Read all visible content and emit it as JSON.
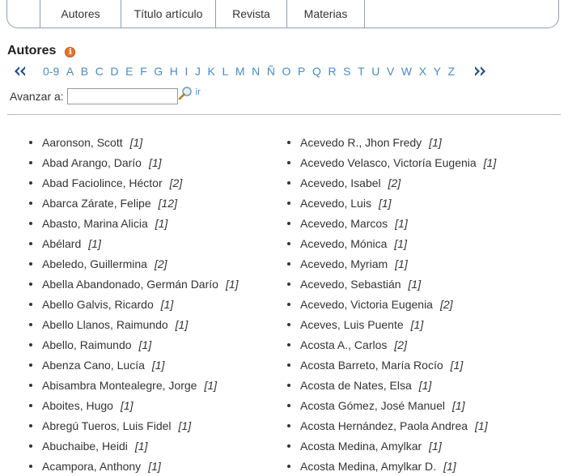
{
  "tabs": [
    "Autores",
    "Título artículo",
    "Revista",
    "Materias"
  ],
  "heading": "Autores",
  "alphabet": [
    "0-9",
    "A",
    "B",
    "C",
    "D",
    "E",
    "F",
    "G",
    "H",
    "I",
    "J",
    "K",
    "L",
    "M",
    "N",
    "Ñ",
    "O",
    "P",
    "Q",
    "R",
    "S",
    "T",
    "U",
    "V",
    "W",
    "X",
    "Y",
    "Z"
  ],
  "jump": {
    "label": "Avanzar a:",
    "value": "",
    "go_label": "ir"
  },
  "icons": {
    "info": "info-icon",
    "prev": "double-chevron-left-icon",
    "next": "double-chevron-right-icon",
    "search": "magnifier-icon"
  },
  "colors": {
    "link": "#4a8bc2",
    "nav_arrow": "#1f4f86",
    "info": "#e8752d",
    "border": "#8a9fb3"
  },
  "authors_left": [
    {
      "name": "Aaronson, Scott",
      "count": "[1]"
    },
    {
      "name": "Abad Arango, Darío",
      "count": "[1]"
    },
    {
      "name": "Abad Faciolince, Héctor",
      "count": "[2]"
    },
    {
      "name": "Abarca Zárate, Felipe",
      "count": "[12]"
    },
    {
      "name": "Abasto, Marina Alicia",
      "count": "[1]"
    },
    {
      "name": "Abélard",
      "count": "[1]"
    },
    {
      "name": "Abeledo, Guillermina",
      "count": "[2]"
    },
    {
      "name": "Abella Abandonado, Germán Darío",
      "count": "[1]"
    },
    {
      "name": "Abello Galvis, Ricardo",
      "count": "[1]"
    },
    {
      "name": "Abello Llanos, Raimundo",
      "count": "[1]"
    },
    {
      "name": "Abello, Raimundo",
      "count": "[1]"
    },
    {
      "name": "Abenza Cano, Lucía",
      "count": "[1]"
    },
    {
      "name": "Abisambra Montealegre, Jorge",
      "count": "[1]"
    },
    {
      "name": "Aboites, Hugo",
      "count": "[1]"
    },
    {
      "name": "Abregú Tueros, Luis Fidel",
      "count": "[1]"
    },
    {
      "name": "Abuchaibe, Heidi",
      "count": "[1]"
    },
    {
      "name": "Acampora, Anthony",
      "count": "[1]"
    }
  ],
  "authors_right": [
    {
      "name": "Acevedo R., Jhon Fredy",
      "count": "[1]"
    },
    {
      "name": "Acevedo Velasco, Victoría Eugenia",
      "count": "[1]"
    },
    {
      "name": "Acevedo, Isabel",
      "count": "[2]"
    },
    {
      "name": "Acevedo, Luis",
      "count": "[1]"
    },
    {
      "name": "Acevedo, Marcos",
      "count": "[1]"
    },
    {
      "name": "Acevedo, Mónica",
      "count": "[1]"
    },
    {
      "name": "Acevedo, Myriam",
      "count": "[1]"
    },
    {
      "name": "Acevedo, Sebastián",
      "count": "[1]"
    },
    {
      "name": "Acevedo, Victoria Eugenia",
      "count": "[2]"
    },
    {
      "name": "Aceves, Luis Puente",
      "count": "[1]"
    },
    {
      "name": "Acosta A., Carlos",
      "count": "[2]"
    },
    {
      "name": "Acosta Barreto, María Rocío",
      "count": "[1]"
    },
    {
      "name": "Acosta de Nates, Elsa",
      "count": "[1]"
    },
    {
      "name": "Acosta Gómez, José Manuel",
      "count": "[1]"
    },
    {
      "name": "Acosta Hernández, Paola Andrea",
      "count": "[1]"
    },
    {
      "name": "Acosta Medina, Amylkar",
      "count": "[1]"
    },
    {
      "name": "Acosta Medina, Amylkar D.",
      "count": "[1]"
    }
  ]
}
